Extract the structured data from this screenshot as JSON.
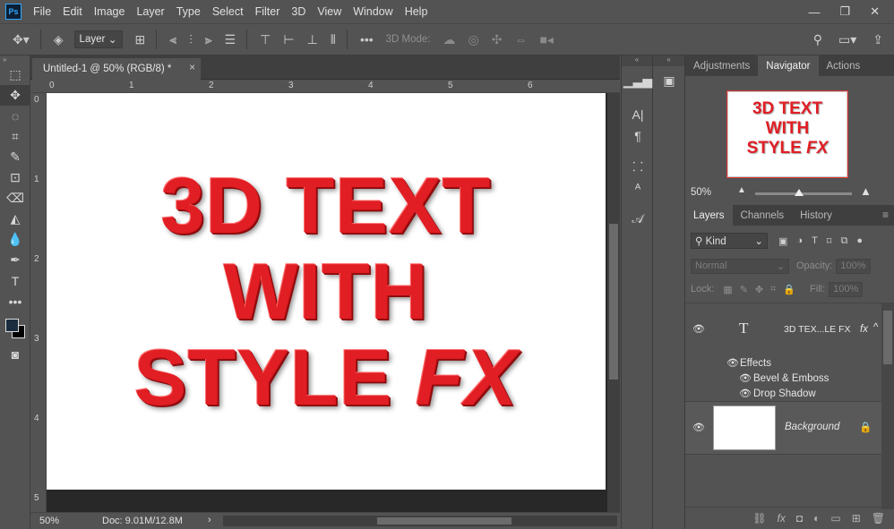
{
  "app": {
    "logo": "Ps"
  },
  "menu": [
    "File",
    "Edit",
    "Image",
    "Layer",
    "Type",
    "Select",
    "Filter",
    "3D",
    "View",
    "Window",
    "Help"
  ],
  "window_controls": {
    "minimize": "—",
    "restore": "❐",
    "close": "✕"
  },
  "options_bar": {
    "auto_select_value": "Layer",
    "three_d_mode_label": "3D Mode:"
  },
  "document": {
    "tab_title": "Untitled-1 @ 50% (RGB/8) *",
    "close_glyph": "×",
    "ruler_top": [
      "0",
      "1",
      "2",
      "3",
      "4",
      "5",
      "6"
    ],
    "ruler_left": [
      "0",
      "1",
      "2",
      "3",
      "4",
      "5"
    ],
    "art_lines": [
      "3D TEXT",
      "WITH",
      "STYLE",
      "FX"
    ],
    "zoom": "50%",
    "doc_info": "Doc: 9.01M/12.8M",
    "status_arrow": "›"
  },
  "top_panel": {
    "tabs": [
      "Adjustments",
      "Navigator",
      "Actions"
    ],
    "active_tab": "Navigator",
    "nav_lines": [
      "3D TEXT",
      "WITH",
      "STYLE",
      "FX"
    ],
    "zoom": "50%",
    "zoom_level_percent": 50
  },
  "layers_panel": {
    "tabs": [
      "Layers",
      "Channels",
      "History"
    ],
    "active_tab": "Layers",
    "filter_kind": "Kind",
    "blend_mode": "Normal",
    "opacity_label": "Opacity:",
    "opacity_value": "100%",
    "lock_label": "Lock:",
    "fill_label": "Fill:",
    "fill_value": "100%",
    "layers": [
      {
        "name": "3D TEX...LE FX",
        "type_glyph": "T",
        "fx": "fx",
        "effects_label": "Effects",
        "effects": [
          "Bevel & Emboss",
          "Drop Shadow"
        ]
      },
      {
        "name": "Background"
      }
    ]
  },
  "colors": {
    "accent": "#31a8ff",
    "art_red": "#e01e24",
    "panel_bg": "#535353",
    "dark_bg": "#282828"
  }
}
